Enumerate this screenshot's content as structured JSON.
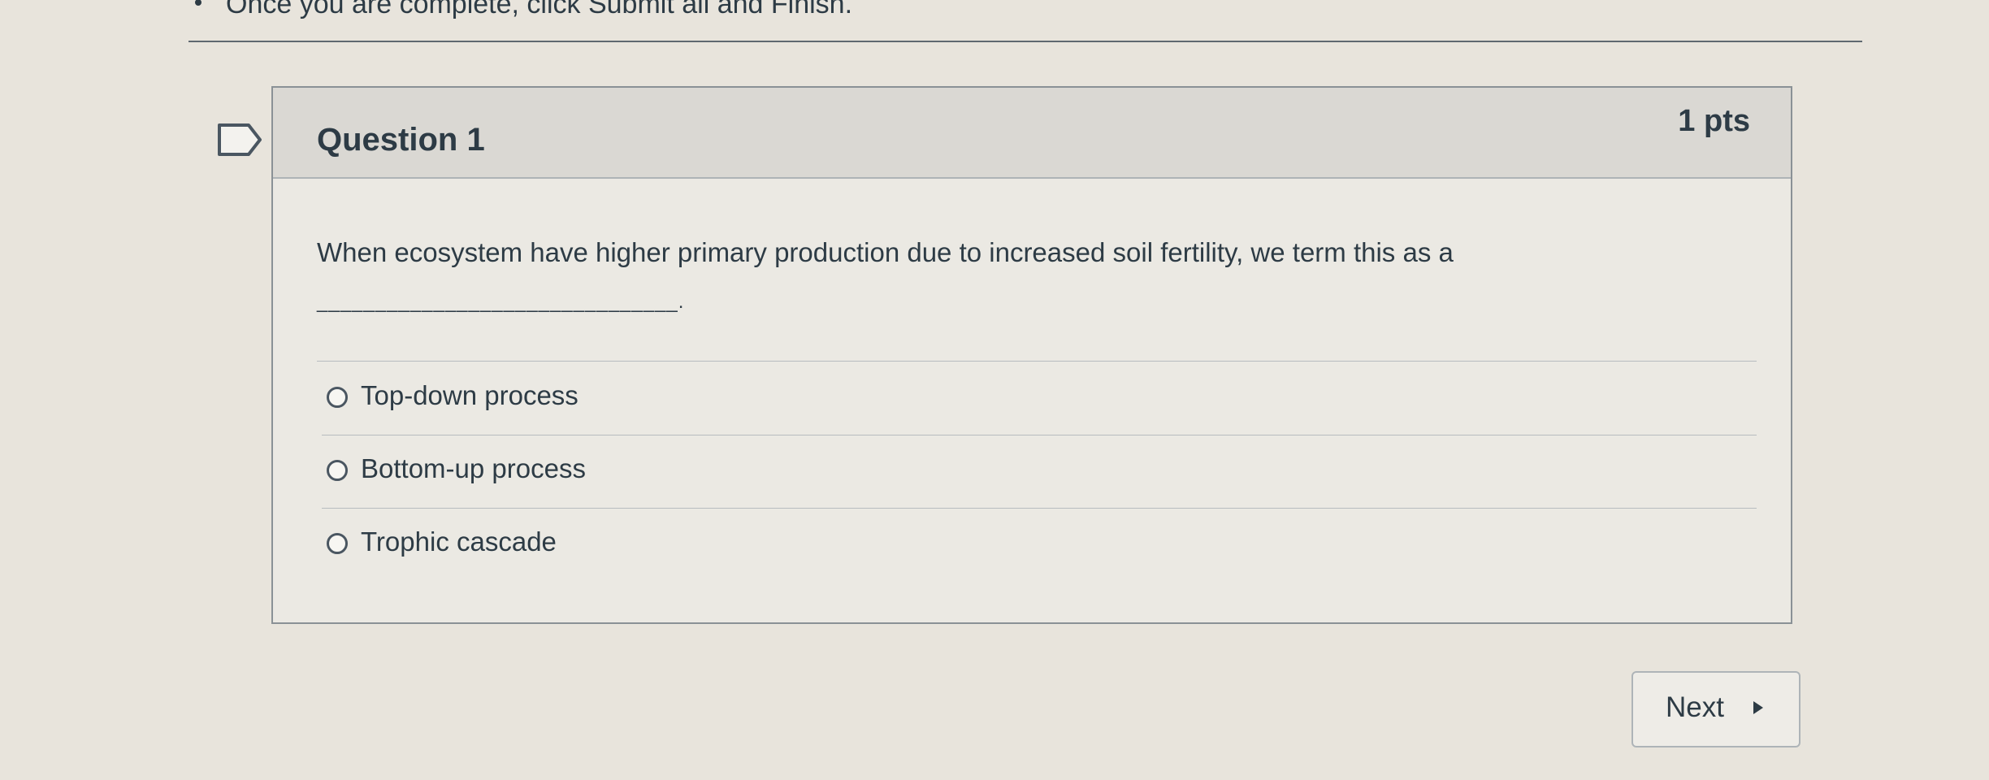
{
  "instruction": {
    "text": "Once you are complete, click Submit all and Finish."
  },
  "question": {
    "title": "Question 1",
    "points": "1 pts",
    "prompt": "When ecosystem have higher primary production due to increased soil fertility, we term this as a",
    "blank": "_______________________________.",
    "answers": [
      {
        "label": "Top-down process",
        "selected": false
      },
      {
        "label": "Bottom-up process",
        "selected": false
      },
      {
        "label": "Trophic cascade",
        "selected": false
      }
    ]
  },
  "navigation": {
    "next_label": "Next"
  },
  "icons": {
    "flag": "flag-icon",
    "next_arrow": "caret-right-icon",
    "bullet": "bullet-icon"
  },
  "colors": {
    "text": "#2d3b45",
    "page_background": "#e8e4dc",
    "card_background": "#ebe9e3",
    "header_background": "#dad8d3",
    "border": "#8a9196"
  }
}
